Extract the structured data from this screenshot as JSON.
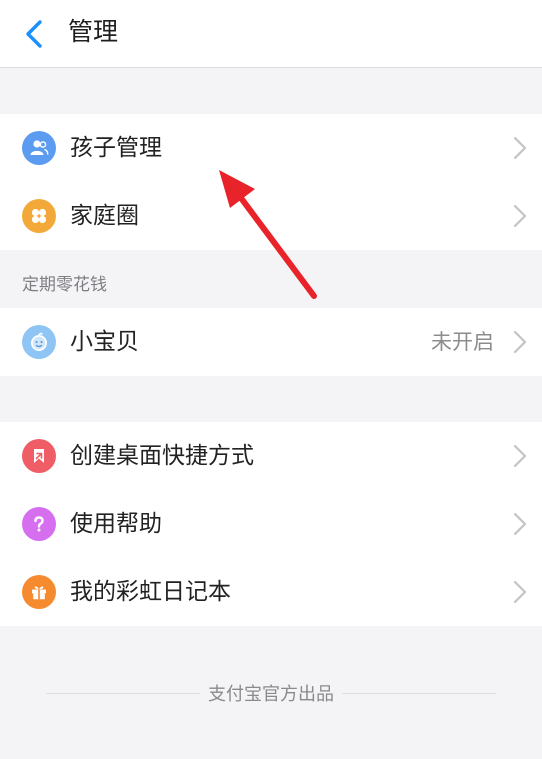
{
  "header": {
    "title": "管理",
    "back_icon": "chevron-left-icon"
  },
  "group1": {
    "items": [
      {
        "label": "孩子管理",
        "icon": "users-icon",
        "icon_color": "#5b9bf0"
      },
      {
        "label": "家庭圈",
        "icon": "clover-icon",
        "icon_color": "#f3a93a"
      }
    ]
  },
  "section2": {
    "header": "定期零花钱"
  },
  "group2": {
    "items": [
      {
        "label": "小宝贝",
        "value": "未开启",
        "icon": "baby-face-icon",
        "icon_color": "#8ec5f5"
      }
    ]
  },
  "group3": {
    "items": [
      {
        "label": "创建桌面快捷方式",
        "icon": "shortcut-icon",
        "icon_color": "#ef5d67"
      },
      {
        "label": "使用帮助",
        "icon": "question-icon",
        "icon_color": "#d66ef0"
      },
      {
        "label": "我的彩虹日记本",
        "icon": "gift-icon",
        "icon_color": "#f58a2e"
      }
    ]
  },
  "footer": {
    "text": "支付宝官方出品"
  },
  "colors": {
    "accent": "#1a8fff",
    "annotation_arrow": "#e8232a"
  }
}
